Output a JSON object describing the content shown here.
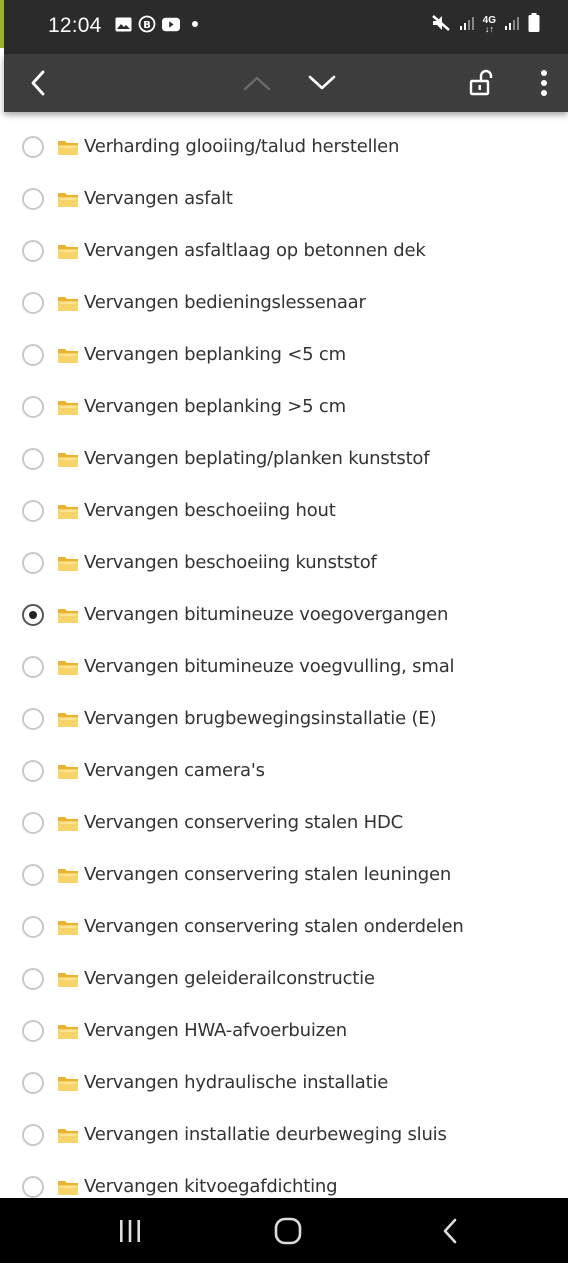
{
  "status": {
    "time": "12:04",
    "left_icons": [
      "gallery-icon",
      "b-badge-icon",
      "youtube-icon"
    ],
    "right_icons": [
      "mute-icon",
      "signal-icon",
      "network-4g-icon",
      "signal-icon",
      "battery-icon"
    ],
    "network_label": "4G"
  },
  "toolbar": {
    "back": "back-icon",
    "prev": "chevron-up-icon",
    "next": "chevron-down-icon",
    "lock": "unlock-icon",
    "menu": "more-vert-icon"
  },
  "items": [
    {
      "label": "Verharding glooiing/talud herstellen",
      "checked": false
    },
    {
      "label": "Vervangen asfalt",
      "checked": false
    },
    {
      "label": "Vervangen asfaltlaag op betonnen dek",
      "checked": false
    },
    {
      "label": "Vervangen bedieningslessenaar",
      "checked": false
    },
    {
      "label": "Vervangen beplanking <5 cm",
      "checked": false
    },
    {
      "label": "Vervangen beplanking >5 cm",
      "checked": false
    },
    {
      "label": "Vervangen beplating/planken kunststof",
      "checked": false
    },
    {
      "label": "Vervangen beschoeiing hout",
      "checked": false
    },
    {
      "label": "Vervangen beschoeiing kunststof",
      "checked": false
    },
    {
      "label": "Vervangen bitumineuze voegovergangen",
      "checked": true
    },
    {
      "label": "Vervangen bitumineuze voegvulling, smal",
      "checked": false
    },
    {
      "label": "Vervangen brugbewegingsinstallatie (E)",
      "checked": false
    },
    {
      "label": "Vervangen camera's",
      "checked": false
    },
    {
      "label": "Vervangen conservering stalen HDC",
      "checked": false
    },
    {
      "label": "Vervangen conservering stalen leuningen",
      "checked": false
    },
    {
      "label": "Vervangen conservering stalen onderdelen",
      "checked": false
    },
    {
      "label": "Vervangen geleiderailconstructie",
      "checked": false
    },
    {
      "label": "Vervangen HWA-afvoerbuizen",
      "checked": false
    },
    {
      "label": "Vervangen hydraulische installatie",
      "checked": false
    },
    {
      "label": "Vervangen installatie deurbeweging sluis",
      "checked": false
    },
    {
      "label": "Vervangen kitvoegafdichting",
      "checked": false
    }
  ],
  "navbar": {
    "recents": "recents-icon",
    "home": "home-icon",
    "back": "nav-back-icon"
  },
  "colors": {
    "statusbar": "#2b2b2b",
    "toolbar": "#3d3d3d",
    "accent": "#9bb32a",
    "folder": "#f0c040"
  }
}
